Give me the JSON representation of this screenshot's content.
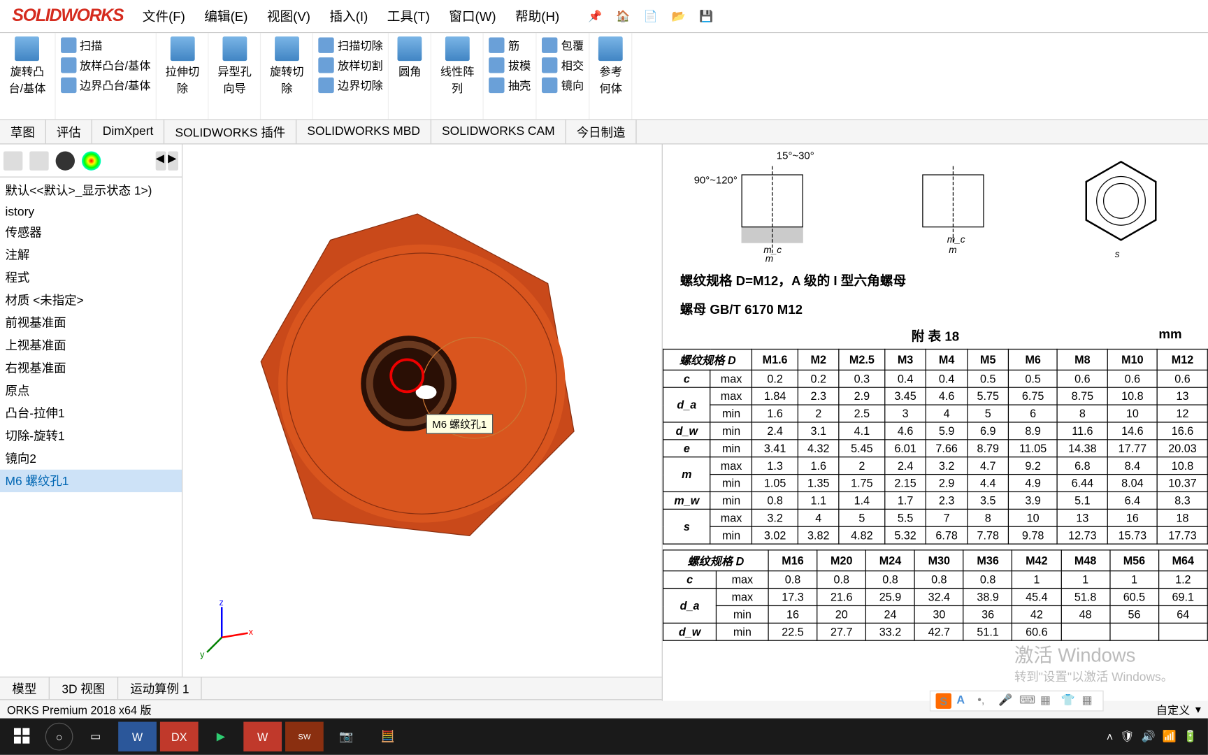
{
  "app": {
    "logo": "SOLIDWORKS"
  },
  "menu": {
    "file": "文件(F)",
    "edit": "编辑(E)",
    "view": "视图(V)",
    "insert": "插入(I)",
    "tools": "工具(T)",
    "window": "窗口(W)",
    "help": "帮助(H)"
  },
  "ribbon": {
    "extrude": "旋转凸\n台/基体",
    "sweep": "扫描",
    "loft": "放样凸台/基体",
    "boundary": "边界凸台/基体",
    "cut_extrude": "拉伸切\n除",
    "hole": "异型孔\n向导",
    "cut_rev": "旋转切\n除",
    "cut_sweep": "扫描切除",
    "cut_loft": "放样切割",
    "cut_boundary": "边界切除",
    "fillet": "圆角",
    "pattern": "线性阵\n列",
    "rib": "筋",
    "draft": "拔模",
    "shell": "抽壳",
    "wrap": "包覆",
    "intersect": "相交",
    "mirror": "镜向",
    "ref": "参考\n何体"
  },
  "tabs": {
    "sketch": "草图",
    "eval": "评估",
    "dim": "DimXpert",
    "plugin": "SOLIDWORKS 插件",
    "mbd": "SOLIDWORKS MBD",
    "cam": "SOLIDWORKS CAM",
    "today": "今日制造"
  },
  "tree": {
    "config": "默认<<默认>_显示状态 1>)",
    "items": [
      "istory",
      "传感器",
      "注解",
      "程式",
      "材质 <未指定>",
      "前视基准面",
      "上视基准面",
      "右视基准面",
      "原点",
      "凸台-拉伸1",
      "切除-旋转1",
      "镜向2",
      "M6 螺纹孔1"
    ]
  },
  "viewport": {
    "tooltip": "M6 螺纹孔1"
  },
  "doc": {
    "spec1": "螺纹规格 D=M12，A 级的 I 型六角螺母",
    "spec2": "螺母    GB/T 6170    M12",
    "att": "附 表 18",
    "unit": "mm",
    "col_h": "螺纹规格 D",
    "col1": [
      "M1.6",
      "M2",
      "M2.5",
      "M3",
      "M4",
      "M5",
      "M6",
      "M8",
      "M10",
      "M12"
    ],
    "rows1": [
      {
        "k": "c",
        "s": "max",
        "v": [
          "0.2",
          "0.2",
          "0.3",
          "0.4",
          "0.4",
          "0.5",
          "0.5",
          "0.6",
          "0.6",
          "0.6"
        ]
      },
      {
        "k": "d_a",
        "s": "max",
        "v": [
          "1.84",
          "2.3",
          "2.9",
          "3.45",
          "4.6",
          "5.75",
          "6.75",
          "8.75",
          "10.8",
          "13"
        ]
      },
      {
        "k": "",
        "s": "min",
        "v": [
          "1.6",
          "2",
          "2.5",
          "3",
          "4",
          "5",
          "6",
          "8",
          "10",
          "12"
        ]
      },
      {
        "k": "d_w",
        "s": "min",
        "v": [
          "2.4",
          "3.1",
          "4.1",
          "4.6",
          "5.9",
          "6.9",
          "8.9",
          "11.6",
          "14.6",
          "16.6"
        ]
      },
      {
        "k": "e",
        "s": "min",
        "v": [
          "3.41",
          "4.32",
          "5.45",
          "6.01",
          "7.66",
          "8.79",
          "11.05",
          "14.38",
          "17.77",
          "20.03"
        ]
      },
      {
        "k": "m",
        "s": "max",
        "v": [
          "1.3",
          "1.6",
          "2",
          "2.4",
          "3.2",
          "4.7",
          "9.2",
          "6.8",
          "8.4",
          "10.8"
        ]
      },
      {
        "k": "",
        "s": "min",
        "v": [
          "1.05",
          "1.35",
          "1.75",
          "2.15",
          "2.9",
          "4.4",
          "4.9",
          "6.44",
          "8.04",
          "10.37"
        ]
      },
      {
        "k": "m_w",
        "s": "min",
        "v": [
          "0.8",
          "1.1",
          "1.4",
          "1.7",
          "2.3",
          "3.5",
          "3.9",
          "5.1",
          "6.4",
          "8.3"
        ]
      },
      {
        "k": "s",
        "s": "max",
        "v": [
          "3.2",
          "4",
          "5",
          "5.5",
          "7",
          "8",
          "10",
          "13",
          "16",
          "18"
        ]
      },
      {
        "k": "",
        "s": "min",
        "v": [
          "3.02",
          "3.82",
          "4.82",
          "5.32",
          "6.78",
          "7.78",
          "9.78",
          "12.73",
          "15.73",
          "17.73"
        ]
      }
    ],
    "col2": [
      "M16",
      "M20",
      "M24",
      "M30",
      "M36",
      "M42",
      "M48",
      "M56",
      "M64"
    ],
    "rows2": [
      {
        "k": "c",
        "s": "max",
        "v": [
          "0.8",
          "0.8",
          "0.8",
          "0.8",
          "0.8",
          "1",
          "1",
          "1",
          "1.2"
        ]
      },
      {
        "k": "d_a",
        "s": "max",
        "v": [
          "17.3",
          "21.6",
          "25.9",
          "32.4",
          "38.9",
          "45.4",
          "51.8",
          "60.5",
          "69.1"
        ]
      },
      {
        "k": "",
        "s": "min",
        "v": [
          "16",
          "20",
          "24",
          "30",
          "36",
          "42",
          "48",
          "56",
          "64"
        ]
      },
      {
        "k": "d_w",
        "s": "min",
        "v": [
          "22.5",
          "27.7",
          "33.2",
          "42.7",
          "51.1",
          "60.6",
          "",
          "",
          ""
        ]
      }
    ]
  },
  "btabs": {
    "model": "模型",
    "v3d": "3D 视图",
    "motion": "运动算例 1"
  },
  "status": {
    "ver": "ORKS Premium 2018 x64 版",
    "custom": "自定义"
  },
  "watermark": {
    "t1": "激活 Windows",
    "t2": "转到\"设置\"以激活 Windows。"
  },
  "ime": {
    "s": "S",
    "a": "A"
  },
  "triad": {
    "x": "x",
    "y": "y",
    "z": "z"
  },
  "angles": {
    "top": "15°~30°",
    "left": "90°~120°"
  }
}
